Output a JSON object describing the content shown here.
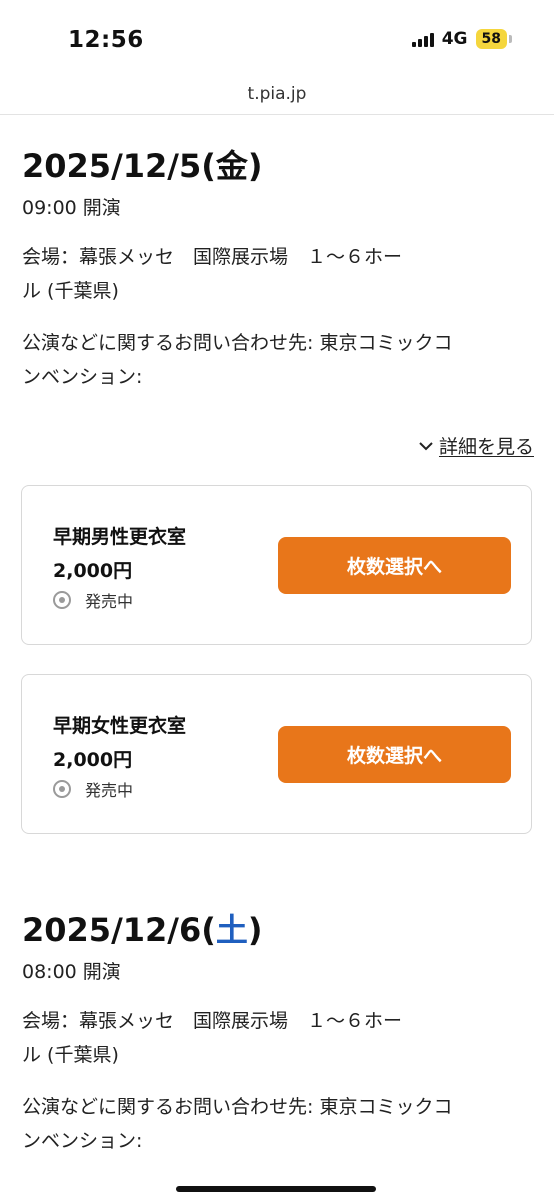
{
  "status_bar": {
    "time": "12:56",
    "network": "4G",
    "battery": "58"
  },
  "browser": {
    "url": "t.pia.jp"
  },
  "events": [
    {
      "date": "2025/12/5(",
      "weekday": "金",
      "date_close": ")",
      "start_time": "09:00 開演",
      "venue_line1": "会場：幕張メッセ　国際展示場　１～６ホー",
      "venue_line2": "ル (千葉県)",
      "contact_line1": "公演などに関するお問い合わせ先: 東京コミックコ",
      "contact_line2": "ンベンション:",
      "details_label": "詳細を見る",
      "tickets": [
        {
          "name": "早期男性更衣室",
          "price": "2,000円",
          "status": "発売中",
          "button": "枚数選択へ"
        },
        {
          "name": "早期女性更衣室",
          "price": "2,000円",
          "status": "発売中",
          "button": "枚数選択へ"
        }
      ]
    },
    {
      "date": "2025/12/6(",
      "weekday": "土",
      "date_close": ")",
      "start_time": "08:00 開演",
      "venue_line1": "会場：幕張メッセ　国際展示場　１～６ホー",
      "venue_line2": "ル (千葉県)",
      "contact_line1": "公演などに関するお問い合わせ先: 東京コミックコ",
      "contact_line2": "ンベンション:"
    }
  ],
  "colors": {
    "accent": "#e8761a",
    "saturday": "#1f5fbf"
  }
}
